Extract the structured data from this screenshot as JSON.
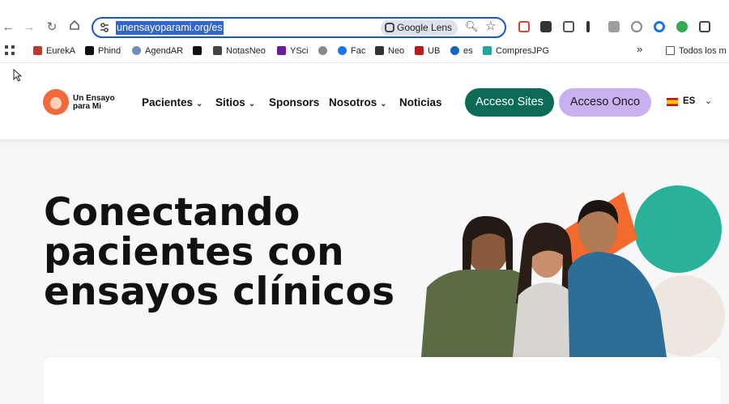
{
  "browser": {
    "url": "unensayoparami.org/es",
    "lens_label": "Google Lens",
    "bookmarks": [
      {
        "label": "EurekA",
        "color": "#c0392b"
      },
      {
        "label": "Phind",
        "color": "#111111"
      },
      {
        "label": "AgendAR",
        "color": "#6c8ebf"
      },
      {
        "label": "",
        "color": "#111111"
      },
      {
        "label": "NotasNeo",
        "color": "#444444"
      },
      {
        "label": "YSci",
        "color": "#6a1b9a"
      },
      {
        "label": "",
        "color": "#888888"
      },
      {
        "label": "Fac",
        "color": "#1877f2"
      },
      {
        "label": "Neo",
        "color": "#333333"
      },
      {
        "label": "UB",
        "color": "#b71c1c"
      },
      {
        "label": "es",
        "color": "#1565c0"
      },
      {
        "label": "CompresJPG",
        "color": "#26a69a"
      }
    ],
    "overflow_label": "»",
    "all_bookmarks_label": "Todos los m"
  },
  "site": {
    "logo_text": "Un Ensayo para Mi",
    "menu": [
      {
        "label": "Pacientes",
        "has_dropdown": true
      },
      {
        "label": "Sitios",
        "has_dropdown": true
      },
      {
        "label": "Sponsors",
        "has_dropdown": false
      },
      {
        "label": "Nosotros",
        "has_dropdown": true
      },
      {
        "label": "Noticias",
        "has_dropdown": false
      }
    ],
    "btn_sites": "Acceso Sites",
    "btn_onco": "Acceso Onco",
    "lang": "ES",
    "colors": {
      "primary": "#0b6b57",
      "secondary": "#c8b1ee",
      "accent_orange": "#f26a2e",
      "accent_teal": "#29b19a"
    }
  },
  "hero": {
    "title": "Conectando pacientes con ensayos clínicos"
  }
}
